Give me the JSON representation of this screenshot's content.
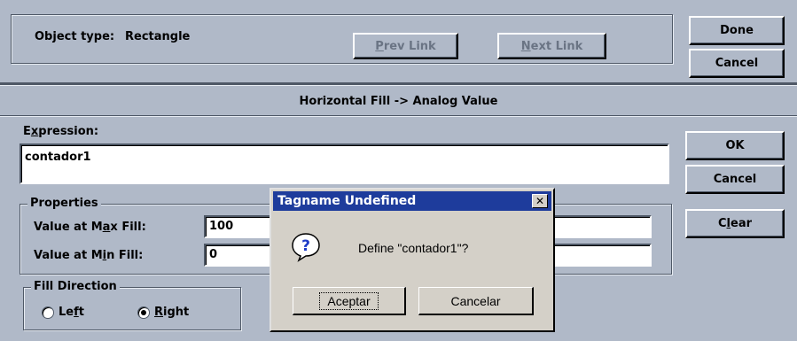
{
  "header": {
    "object_type_label": "Object type:",
    "object_type_value": "Rectangle",
    "prev_link": {
      "pre": "",
      "key": "P",
      "post": "rev Link"
    },
    "next_link": {
      "pre": "",
      "key": "N",
      "post": "ext Link"
    },
    "done": "Done",
    "cancel": "Cancel"
  },
  "animation_title": "Horizontal Fill -> Analog Value",
  "expression": {
    "label": {
      "pre": "E",
      "key": "x",
      "post": "pression:"
    },
    "value": "contador1"
  },
  "side_buttons": {
    "ok": "OK",
    "cancel": "Cancel",
    "clear": {
      "pre": "C",
      "key": "l",
      "post": "ear"
    }
  },
  "properties": {
    "title": "Properties",
    "max_fill": {
      "label": {
        "pre": "Value at M",
        "key": "a",
        "post": "x Fill:"
      },
      "value": "100"
    },
    "min_fill": {
      "label": {
        "pre": "Value at M",
        "key": "i",
        "post": "n Fill:"
      },
      "value": "0"
    }
  },
  "fill_direction": {
    "title": "Fill Direction",
    "left": {
      "pre": "Le",
      "key": "f",
      "post": "t"
    },
    "right": {
      "pre": "",
      "key": "R",
      "post": "ight"
    },
    "selected": "right"
  },
  "message_box": {
    "title": "Tagname Undefined",
    "close": "✕",
    "icon": "question-icon",
    "message": "Define \"contador1\"?",
    "accept": "Aceptar",
    "cancel": "Cancelar"
  },
  "colors": {
    "dialog_bg": "#b0b9c8",
    "titlebar": "#1e3c9c",
    "msgbox_bg": "#d4d0c8"
  }
}
